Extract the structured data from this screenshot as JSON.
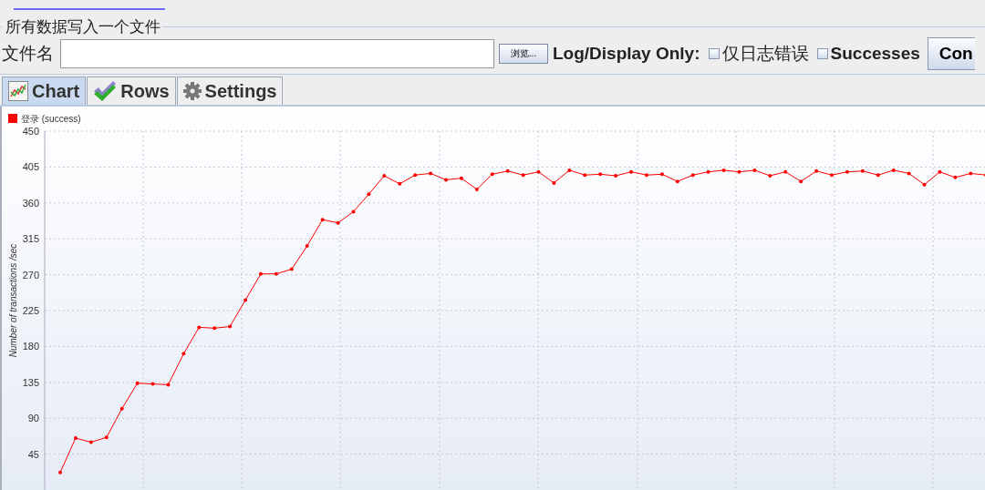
{
  "file_group": {
    "title": "所有数据写入一个文件",
    "filename_label": "文件名",
    "browse_button": "浏览...",
    "log_display_label": "Log/Display Only:",
    "checkboxes": [
      {
        "label": "仅日志错误",
        "checked": false
      },
      {
        "label": "Successes",
        "checked": false
      }
    ],
    "configure_button": "Con"
  },
  "tabs": [
    {
      "label": "Chart",
      "selected": true
    },
    {
      "label": "Rows",
      "selected": false
    },
    {
      "label": "Settings",
      "selected": false
    }
  ],
  "chart_data": {
    "type": "line",
    "grid": true,
    "ylabel": "Number of transactions /sec",
    "ylim": [
      0,
      450
    ],
    "yticks": [
      45,
      90,
      135,
      180,
      225,
      270,
      315,
      360,
      405,
      450
    ],
    "series": [
      {
        "name": "登录 (success)",
        "color": "#ff0000",
        "values": [
          22,
          65,
          60,
          66,
          102,
          134,
          133,
          132,
          171,
          204,
          203,
          205,
          238,
          271,
          271,
          277,
          306,
          339,
          335,
          349,
          371,
          394,
          384,
          395,
          397,
          389,
          391,
          377,
          396,
          400,
          395,
          399,
          385,
          401,
          395,
          396,
          394,
          399,
          395,
          396,
          387,
          395,
          399,
          401,
          399,
          401,
          394,
          399,
          387,
          400,
          395,
          399,
          400,
          395,
          401,
          397,
          383,
          399,
          392,
          397,
          395
        ]
      }
    ]
  }
}
